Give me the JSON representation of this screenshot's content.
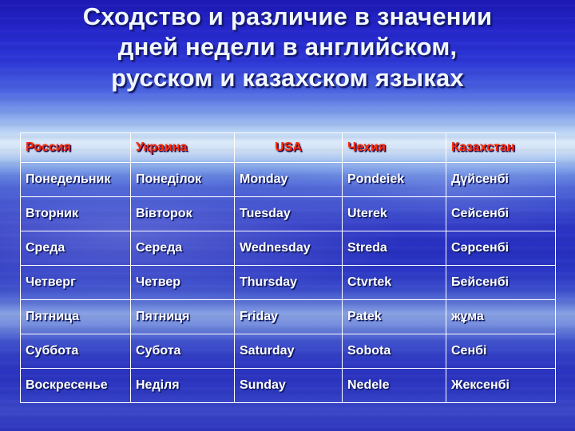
{
  "slide": {
    "title": "Сходство и различие в значении\nдней недели в английском,\nрусском и казахском языках",
    "colors": {
      "title_text": "#f2f7ff",
      "title_shadow": "#131a6e",
      "header_text": "#ff2a08",
      "cell_text": "#ffffff",
      "grid_line": "#ffffff",
      "background_deep_blue": "#2730c0",
      "background_horizon": "#dceaf9"
    }
  },
  "table": {
    "headers": [
      "Россия",
      "Украина",
      "USA",
      "Чехия",
      "Казахстан"
    ],
    "rows": [
      [
        "Понедельник",
        "Понеділок",
        "Monday",
        "Pondeiek",
        "Дүйсенбі"
      ],
      [
        "Вторник",
        "Вівторок",
        "Tuesday",
        "Uterek",
        "Сейсенбі"
      ],
      [
        "Среда",
        "Середа",
        "Wednesday",
        "Streda",
        "Сәрсенбі"
      ],
      [
        "Четверг",
        "Четвер",
        "Thursday",
        "Ctvrtek",
        "Бейсенбі"
      ],
      [
        "Пятница",
        "Пятниця",
        "Friday",
        "Patek",
        "жұма"
      ],
      [
        "Суббота",
        "Субота",
        "Saturday",
        "Sobota",
        "Сенбі"
      ],
      [
        "Воскресенье",
        "Неділя",
        "Sunday",
        "Nedele",
        "Жексенбі"
      ]
    ]
  }
}
